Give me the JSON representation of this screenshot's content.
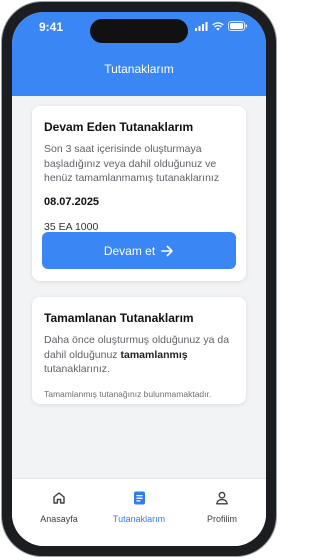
{
  "status_bar": {
    "time": "9:41"
  },
  "header": {
    "title": "Tutanaklarım"
  },
  "ongoing": {
    "title": "Devam Eden Tutanaklarım",
    "description": "Son 3 saat içerisinde oluşturmaya başladığınız veya dahil olduğunuz ve henüz tamamlanmamış tutanaklarınız",
    "date": "08.07.2025",
    "code": "35 EA 1000",
    "button_label": "Devam et"
  },
  "completed": {
    "title": "Tamamlanan Tutanaklarım",
    "description_prefix": "Daha önce oluşturmuş olduğunuz ya da dahil olduğunuz ",
    "description_bold": "tamamlanmış",
    "description_suffix": " tutanaklarınız.",
    "empty_message": "Tamamlanmış tutanağınız bulunmamaktadır."
  },
  "tabs": [
    {
      "label": "Anasayfa",
      "icon": "home-icon",
      "active": false
    },
    {
      "label": "Tutanaklarım",
      "icon": "document-icon",
      "active": true
    },
    {
      "label": "Profilim",
      "icon": "user-icon",
      "active": false
    }
  ],
  "colors": {
    "accent": "#3a86f5",
    "active_tab": "#2f7cf0"
  }
}
